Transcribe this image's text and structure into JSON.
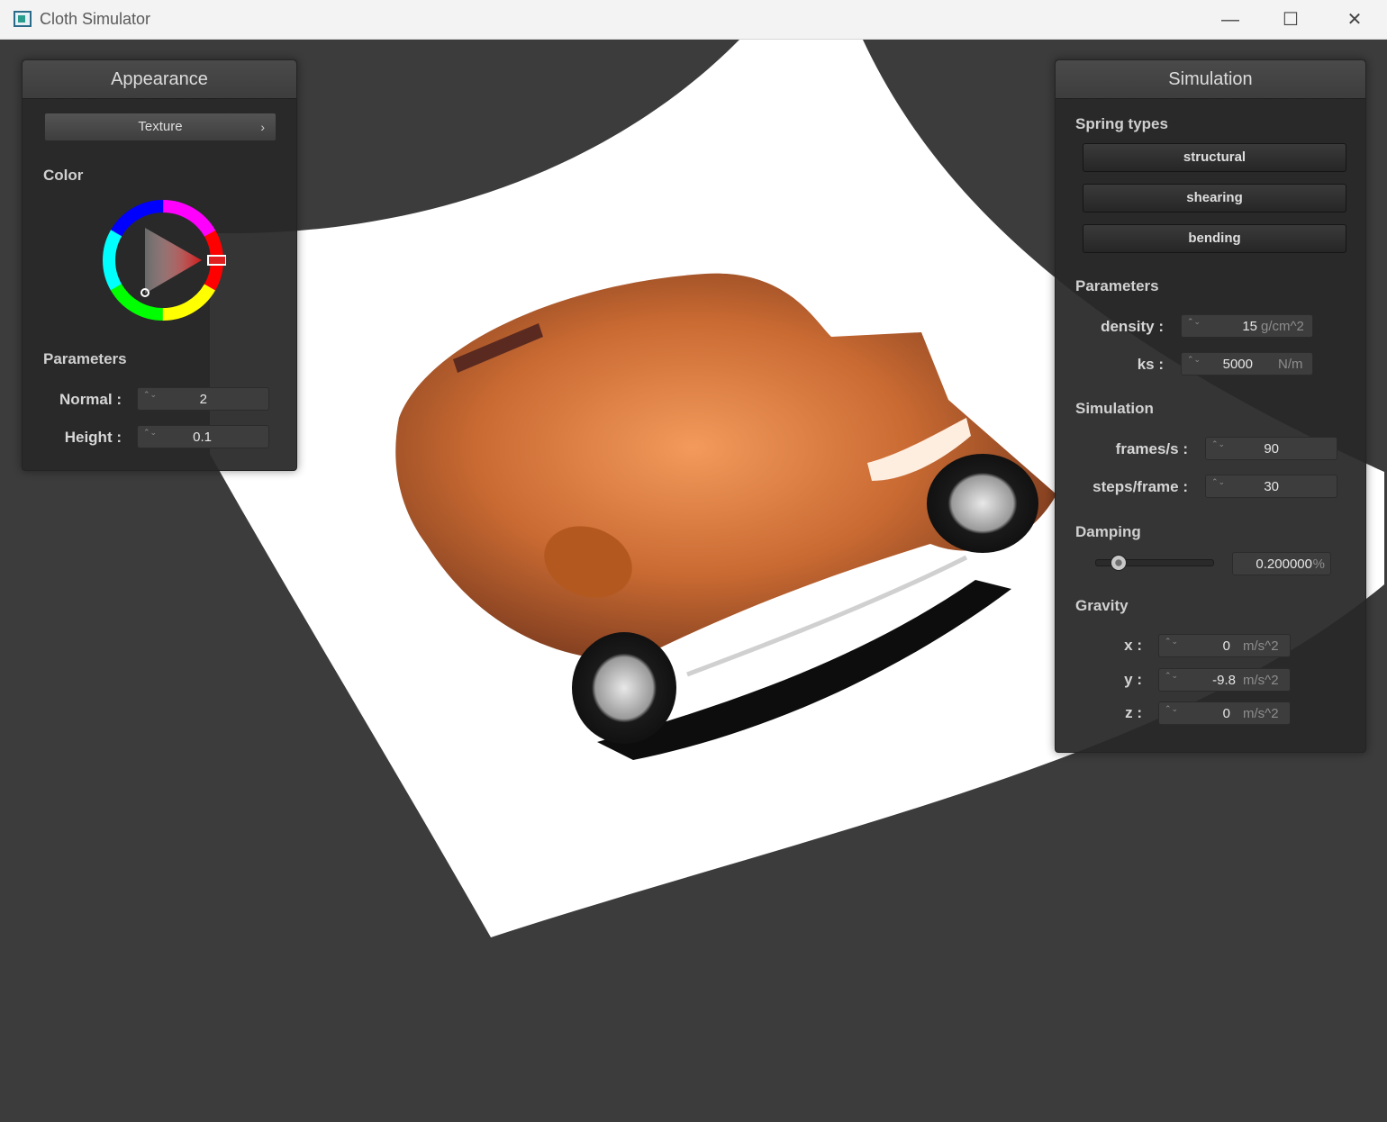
{
  "window": {
    "title": "Cloth Simulator",
    "minimize_glyph": "—",
    "maximize_glyph": "☐",
    "close_glyph": "✕"
  },
  "appearance": {
    "title": "Appearance",
    "texture_label": "Texture",
    "texture_chevron": "›",
    "color_label": "Color",
    "parameters_label": "Parameters",
    "normal_label": "Normal :",
    "normal_value": "2",
    "height_label": "Height :",
    "height_value": "0.1",
    "selected_color": "#cc1a1a"
  },
  "simulation": {
    "title": "Simulation",
    "spring_types_label": "Spring types",
    "spring_types": [
      "structural",
      "shearing",
      "bending"
    ],
    "parameters_label": "Parameters",
    "density_label": "density :",
    "density_value": "15",
    "density_unit": "g/cm^2",
    "ks_label": "ks :",
    "ks_value": "5000",
    "ks_unit": "N/m",
    "simulation_label": "Simulation",
    "fps_label": "frames/s :",
    "fps_value": "90",
    "steps_label": "steps/frame :",
    "steps_value": "30",
    "damping_label": "Damping",
    "damping_value": "0.200000",
    "damping_unit": "%",
    "damping_fraction": 0.2,
    "gravity_label": "Gravity",
    "gx_label": "x :",
    "gx_value": "0",
    "gy_label": "y :",
    "gy_value": "-9.8",
    "gz_label": "z :",
    "gz_value": "0",
    "gravity_unit": "m/s^2"
  },
  "spin_glyph": "⌃⌄",
  "colors": {
    "background": "#3c3c3c",
    "cloth": "#ffffff",
    "panel": "#282828"
  }
}
